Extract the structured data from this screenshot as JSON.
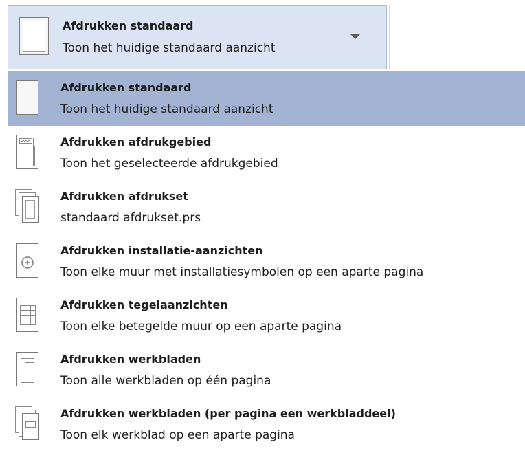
{
  "combo": {
    "title": "Afdrukken standaard",
    "subtitle": "Toon het huidige standaard aanzicht",
    "icon": "blank-page-icon"
  },
  "menu": {
    "items": [
      {
        "title": "Afdrukken standaard",
        "subtitle": "Toon het huidige standaard aanzicht",
        "icon": "blank-page-icon",
        "selected": true
      },
      {
        "title": "Afdrukken afdrukgebied",
        "subtitle": "Toon het geselecteerde afdrukgebied",
        "icon": "print-area-icon",
        "selected": false
      },
      {
        "title": "Afdrukken afdrukset",
        "subtitle": "standaard afdrukset.prs",
        "icon": "print-set-icon",
        "selected": false
      },
      {
        "title": "Afdrukken installatie-aanzichten",
        "subtitle": "Toon elke muur met installatiesymbolen op een aparte pagina",
        "icon": "installation-icon",
        "selected": false
      },
      {
        "title": "Afdrukken tegelaanzichten",
        "subtitle": "Toon elke betegelde muur op een aparte pagina",
        "icon": "tile-grid-icon",
        "selected": false
      },
      {
        "title": "Afdrukken werkbladen",
        "subtitle": "Toon alle werkbladen op één pagina",
        "icon": "worktop-icon",
        "selected": false
      },
      {
        "title": "Afdrukken werkbladen (per pagina een werkbladdeel)",
        "subtitle": "Toon elk werkblad op een aparte pagina",
        "icon": "worktop-pages-icon",
        "selected": false
      }
    ]
  },
  "colors": {
    "selected_bg": "#a2b3d4",
    "combo_bg": "#dae4f2",
    "icon_stroke": "#7a7a7a"
  }
}
